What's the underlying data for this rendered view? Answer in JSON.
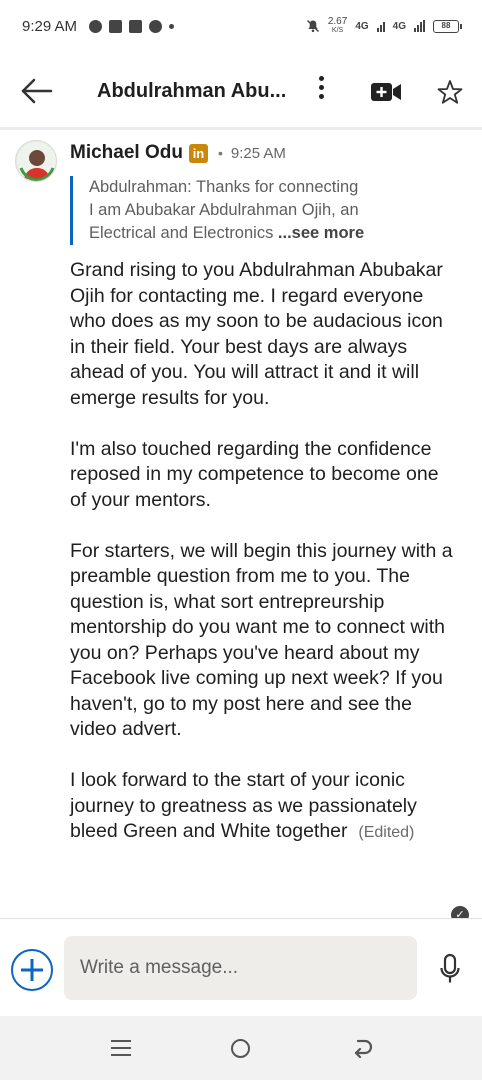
{
  "status_bar": {
    "time": "9:29 AM",
    "net_speed_value": "2.67",
    "net_speed_unit": "K/S",
    "network_1": "4G",
    "network_2": "4G",
    "battery": "88"
  },
  "header": {
    "title": "Abdulrahman Abu..."
  },
  "message": {
    "sender": "Michael Odu",
    "badge": "in",
    "separator": "•",
    "time": "9:25 AM",
    "quote_lines": [
      "Abdulrahman: Thanks for connecting",
      "I am Abubakar Abdulrahman Ojih, an",
      "Electrical and Electronics"
    ],
    "quote_more": "...see more",
    "paragraphs": [
      "Grand rising to you Abdulrahman Abubakar Ojih for contacting me. I regard everyone who does as my soon to be audacious icon in their field. Your best days are always ahead of you. You will attract it and it will emerge results for you.",
      "I'm also touched regarding the confidence reposed in my competence to become one of your mentors.",
      "For starters, we will begin this journey with a preamble question from me to you. The question is, what sort entrepreurship mentorship do you want me to connect with you on? Perhaps you've heard about my Facebook live coming up next week? If you haven't, go to my post here and see the video advert."
    ],
    "last_paragraph": "I look forward to the start of your iconic journey to greatness as we passionately bleed Green and White together",
    "edited_label": "(Edited)"
  },
  "compose": {
    "placeholder": "Write a message..."
  },
  "colors": {
    "accent": "#0a66c2",
    "badge": "#c9880c",
    "input_bg": "#eeede9"
  },
  "icons": [
    "back-arrow-icon",
    "more-vertical-icon",
    "video-call-icon",
    "star-icon",
    "plus-icon",
    "microphone-icon",
    "read-receipt-icon"
  ]
}
